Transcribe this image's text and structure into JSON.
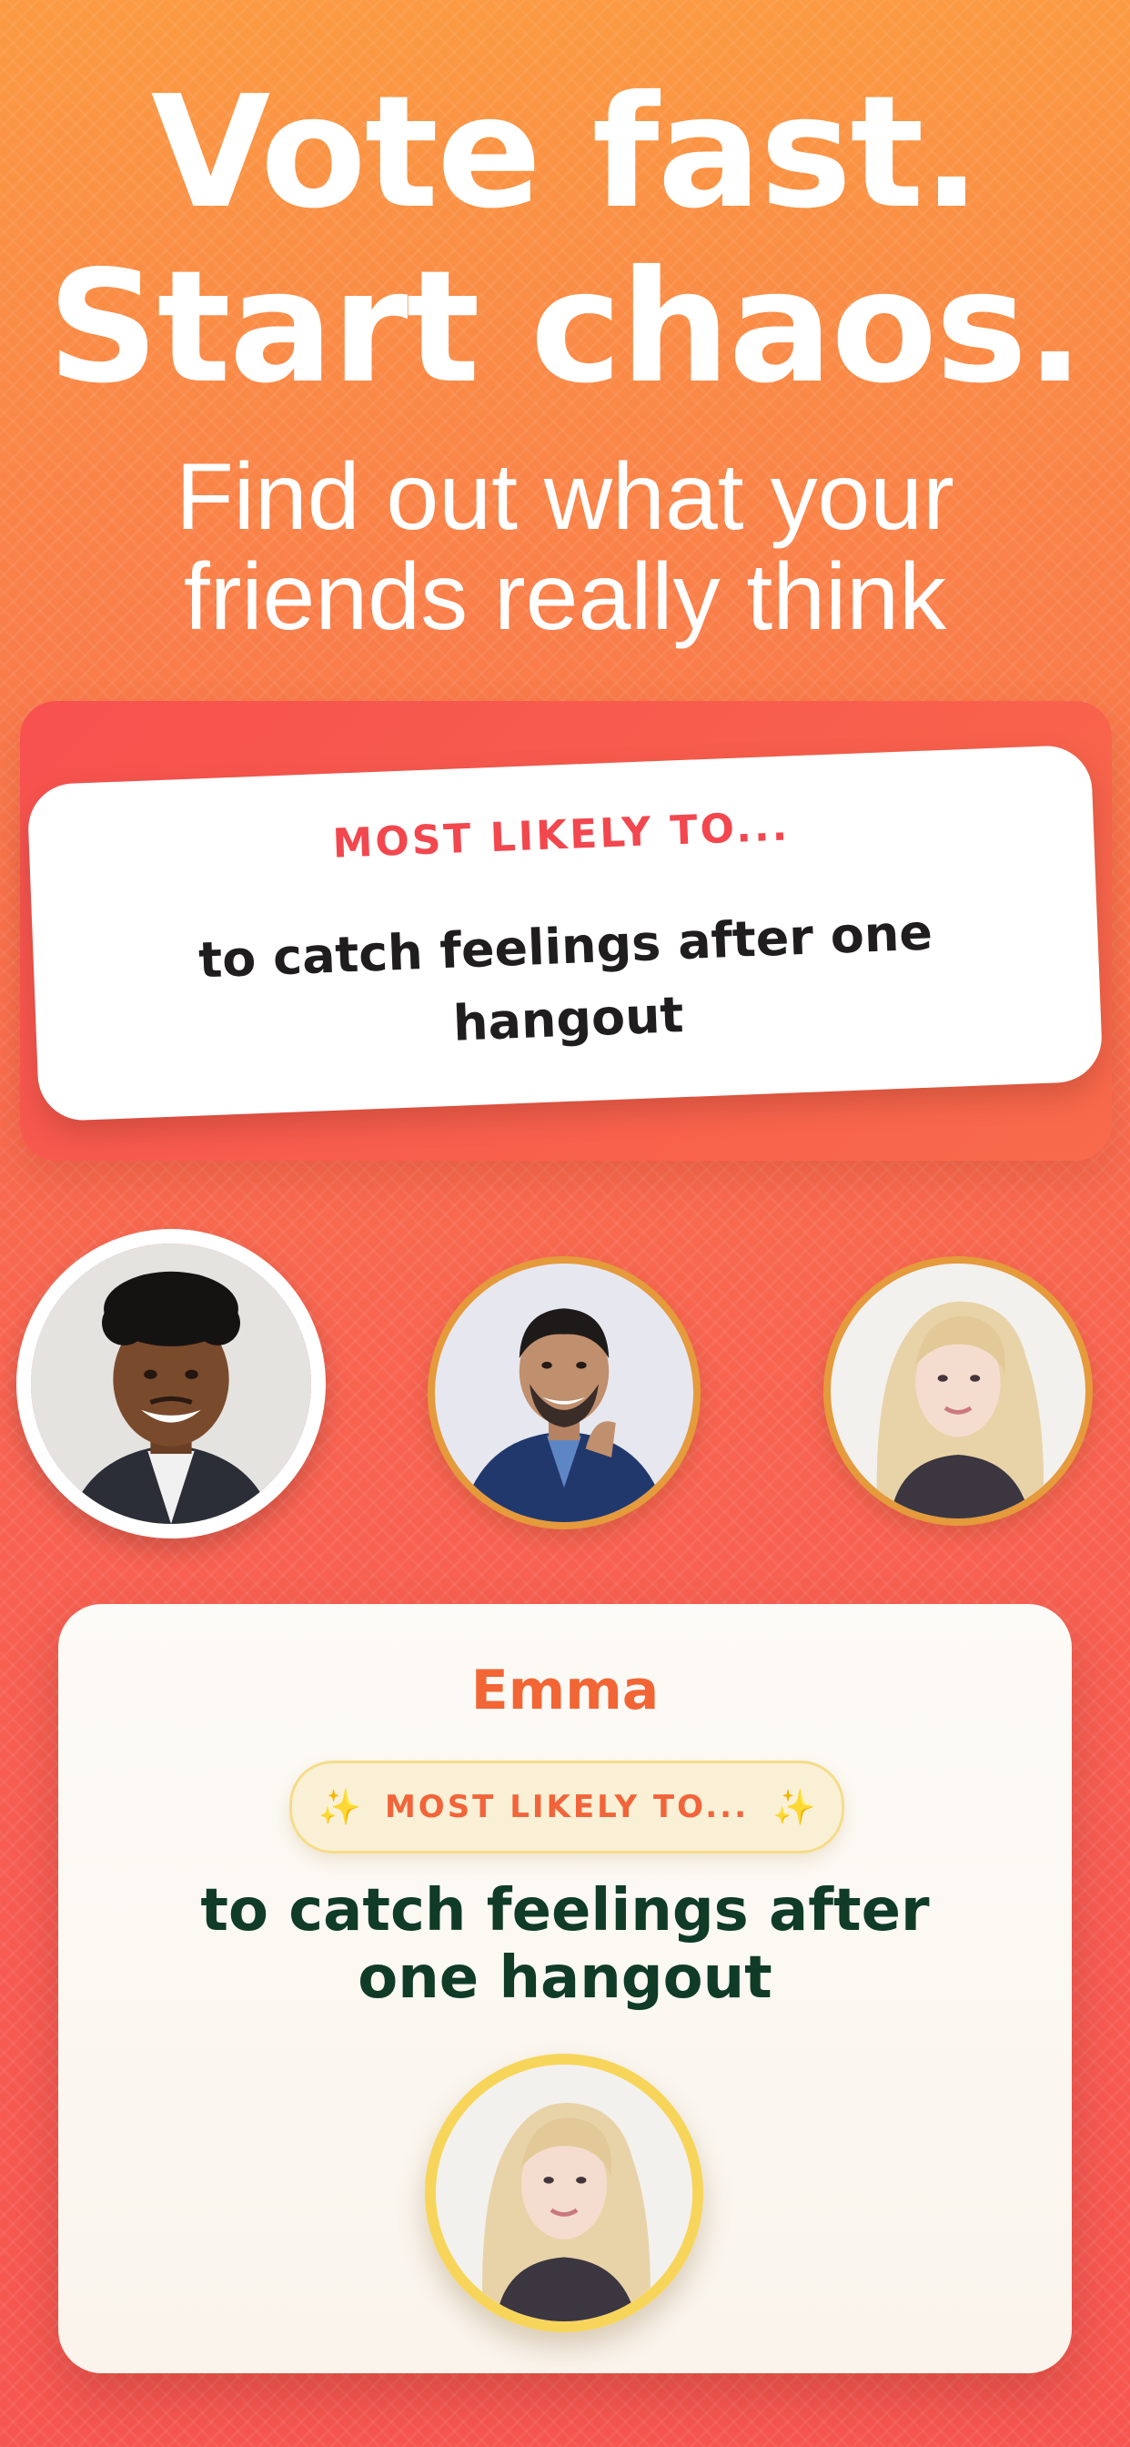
{
  "headline": {
    "line1": "Vote fast.",
    "line2": "Start chaos."
  },
  "subheadline": {
    "line1": "Find out what your",
    "line2": "friends really think"
  },
  "question_card": {
    "label": "MOST LIKELY TO...",
    "text": "to catch feelings after one hangout"
  },
  "avatars": [
    {
      "name": "man-smiling-suit"
    },
    {
      "name": "man-blue-blazer"
    },
    {
      "name": "blonde-woman"
    }
  ],
  "result_card": {
    "name": "Emma",
    "badge_label": "MOST LIKELY TO...",
    "badge_icon": "sparkle-icon",
    "text": "to catch feelings after one hangout"
  },
  "colors": {
    "background_top": "#fb9a42",
    "background_bottom": "#f6564f",
    "question_label": "#f2474e",
    "result_name": "#f26535",
    "result_text": "#0f3b27",
    "avatar_ring": "#e59a3c",
    "winner_ring": "#f7d55a"
  }
}
